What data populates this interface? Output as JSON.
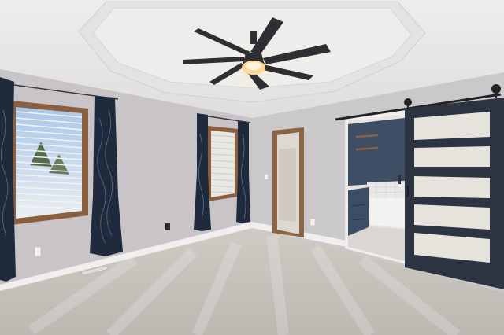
{
  "scene": {
    "description_free": true
  },
  "palette": {
    "ceiling": "#e9e8e7",
    "tray": "#e2e1e0",
    "wall_left": "#c9c5c8",
    "wall_right": "#cfccd0",
    "wall_back": "#c6c3c6",
    "carpet": "#c7c2bd",
    "trim": "#f2f0ee",
    "curtain": "#1f2a3d",
    "door_panel": "#2b3340",
    "glass": "#e6e2dc",
    "window_frame": "#8a5f3f",
    "wood": "#8c6444",
    "fan": "#2f2f33",
    "light": "#ffd79a",
    "bath_wall": "#3e4e64",
    "tile": "#e8e6e6"
  }
}
